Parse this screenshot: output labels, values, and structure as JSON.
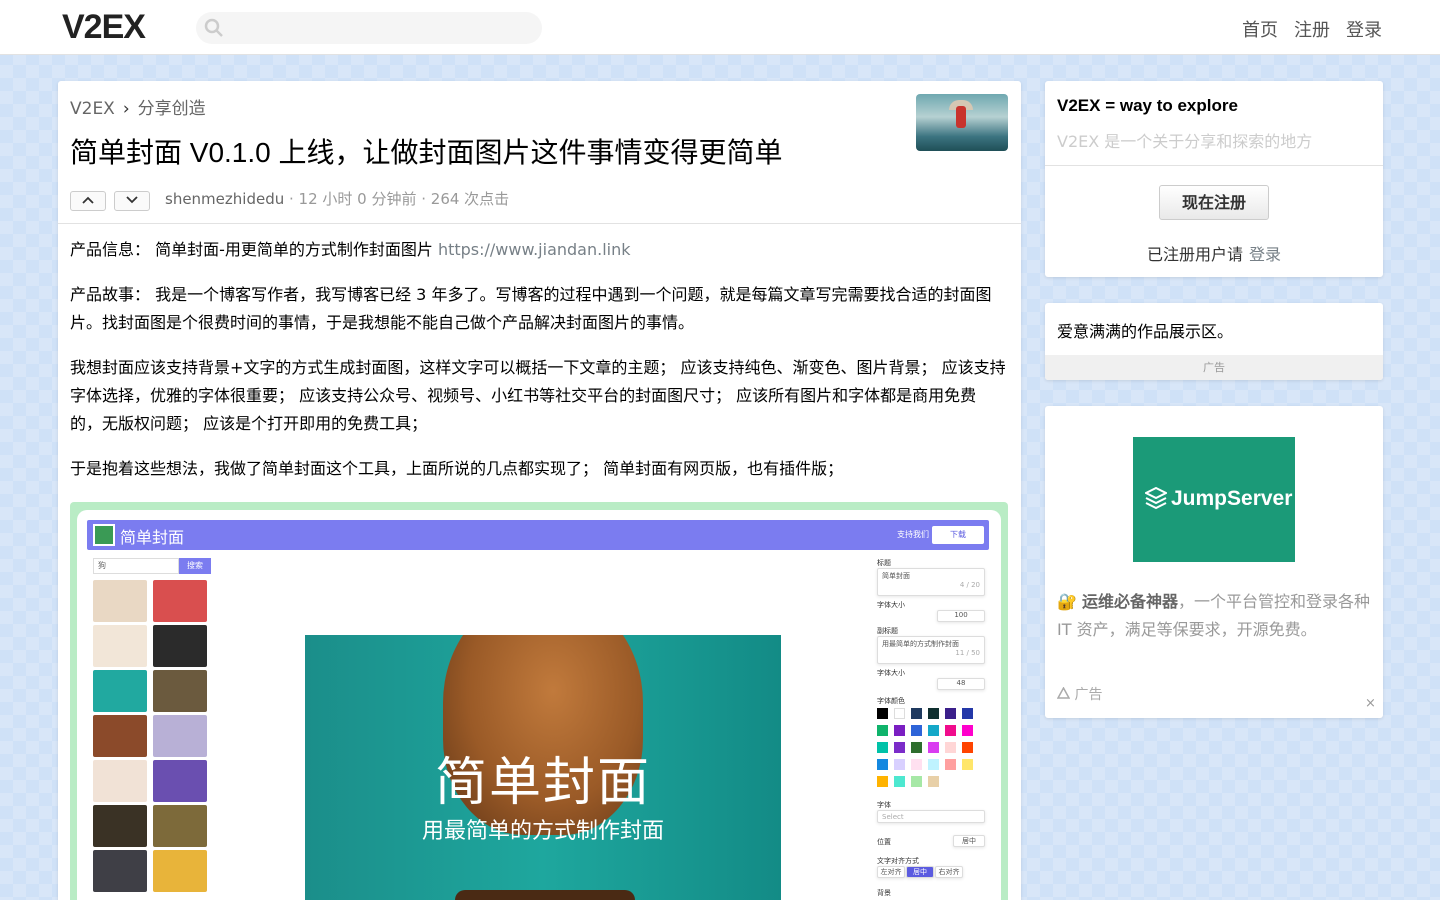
{
  "topbar": {
    "logo": "V2EX",
    "search_placeholder": "",
    "nav": [
      "首页",
      "注册",
      "登录"
    ]
  },
  "post": {
    "breadcrumb": [
      "V2EX",
      "分享创造"
    ],
    "breadcrumb_sep": "›",
    "title": "简单封面 V0.1.0 上线，让做封面图片这件事情变得更简单",
    "author": "shenmezhidedu",
    "meta": " · 12 小时 0 分钟前 · 264 次点击",
    "p1_label": "产品信息： 简单封面-用更简单的方式制作封面图片 ",
    "p1_link": "https://www.jiandan.link",
    "p2": "产品故事： 我是一个博客写作者，我写博客已经 3 年多了。写博客的过程中遇到一个问题，就是每篇文章写完需要找合适的封面图片。找封面图是个很费时间的事情，于是我想能不能自己做个产品解决封面图片的事情。",
    "p3": "我想封面应该支持背景+文字的方式生成封面图，这样文字可以概括一下文章的主题； 应该支持纯色、渐变色、图片背景； 应该支持字体选择，优雅的字体很重要； 应该支持公众号、视频号、小红书等社交平台的封面图尺寸； 应该所有图片和字体都是商用免费的，无版权问题； 应该是个打开即用的免费工具；",
    "p4": "于是抱着这些想法，我做了简单封面这个工具，上面所说的几点都实现了； 简单封面有网页版，也有插件版；"
  },
  "screenshot": {
    "app_title": "简单封面",
    "support": "支持我们",
    "download": "下载",
    "search_value": "狗",
    "search_btn": "搜索",
    "hero_title": "简单封面",
    "hero_sub": "用最简单的方式制作封面",
    "panel": {
      "title_label": "标题",
      "title_value": "简单封面",
      "title_count": "4 / 20",
      "font_size_label": "字体大小",
      "font_size_1": "100",
      "subtitle_label": "副标题",
      "subtitle_value": "用最简单的方式制作封面",
      "subtitle_count": "11 / 50",
      "font_size_label_2": "字体大小",
      "font_size_2": "48",
      "font_color_label": "字体颜色",
      "font_label": "字体",
      "font_select": "Select",
      "position_label": "位置",
      "position_value": "居中",
      "align_label": "文字对齐方式",
      "align_left": "左对齐",
      "align_center": "居中",
      "align_right": "右对齐",
      "bg_label": "背景"
    },
    "thumb_colors": [
      "#e9d8c4",
      "#d94f4f",
      "#f2e6d8",
      "#2b2b2b",
      "#21a9a0",
      "#6b5a3e",
      "#8b4a2a",
      "#b8b0d6",
      "#f1e2d6",
      "#6a4fb0",
      "#3a3225",
      "#7d6a3a",
      "#3f3f46",
      "#e8b43a"
    ],
    "swatch_colors": [
      "#000000",
      "#ffffff",
      "#1f3a5f",
      "#0f2f2f",
      "#3b1f8a",
      "#2438a8",
      "#0fb36b",
      "#7a1ec2",
      "#2e64d8",
      "#14a8c8",
      "#f00c8c",
      "#ff00cc",
      "#00c2a8",
      "#7b2cc9",
      "#2e6e2e",
      "#d93df0",
      "#ffd6d6",
      "#ff4400",
      "#1488e0",
      "#d8d0ff",
      "#ffe0f0",
      "#bff3ff",
      "#ff9f9f",
      "#ffe66a",
      "#ffb300",
      "#4de8d0",
      "#a6e8a6",
      "#e8d0a8"
    ]
  },
  "sidebar": {
    "box1_title": "V2EX = way to explore",
    "box1_sub": "V2EX 是一个关于分享和探索的地方",
    "signup_btn": "现在注册",
    "login_prefix": "已注册用户请",
    "login_link": "登录",
    "box2_text": "爱意满满的作品展示区。",
    "box2_ad": "广告",
    "box3_logo": "JumpServer",
    "box3_emoji": "🔐",
    "box3_bold": "运维必备神器",
    "box3_rest": "，一个平台管控和登录各种 IT 资产，满足等保要求，开源免费。",
    "box3_ad": "广告",
    "box3_close": "×"
  }
}
